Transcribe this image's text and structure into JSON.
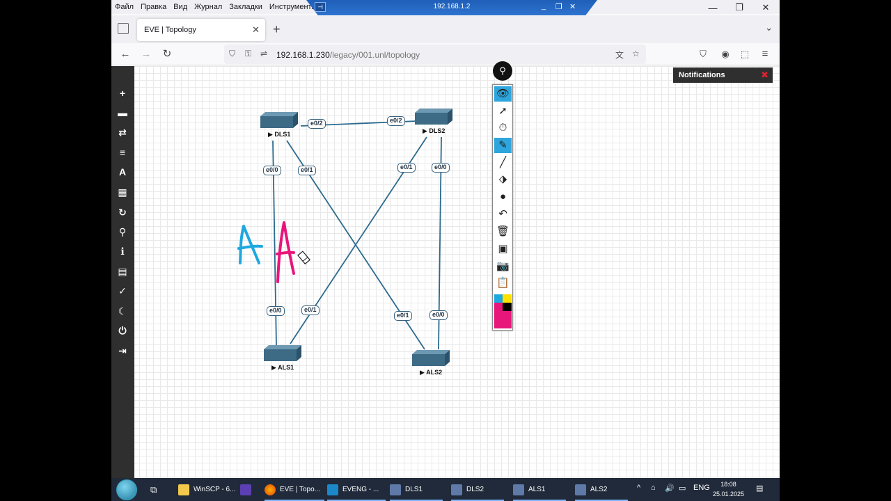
{
  "menubar": {
    "items": [
      "Файл",
      "Правка",
      "Вид",
      "Журнал",
      "Закладки",
      "Инструменты"
    ]
  },
  "rdp": {
    "title": "192.168.1.2",
    "pin": "⊣"
  },
  "tab": {
    "title": "EVE | Topology"
  },
  "url": {
    "host": "192.168.1.230",
    "path": "/legacy/001.unl/topology"
  },
  "notifications": {
    "title": "Notifications"
  },
  "topology": {
    "nodes": [
      {
        "id": "dls1",
        "label": "DLS1"
      },
      {
        "id": "dls2",
        "label": "DLS2"
      },
      {
        "id": "als1",
        "label": "ALS1"
      },
      {
        "id": "als2",
        "label": "ALS2"
      }
    ],
    "interfaces": {
      "dls1_e02": "e0/2",
      "dls2_e02": "e0/2",
      "dls1_e00": "e0/0",
      "dls1_e01": "e0/1",
      "dls2_e01": "e0/1",
      "dls2_e00": "e0/0",
      "als1_e00": "e0/0",
      "als1_e01": "e0/1",
      "als2_e01": "e0/1",
      "als2_e00": "e0/0"
    },
    "annotations": {
      "blue_letter": "A",
      "pink_letter": "A"
    }
  },
  "colors": {
    "link": "#2b6a8e",
    "blue_ink": "#1ea8e0",
    "pink_ink": "#e8157a",
    "tool_active": "#2ea6dd"
  },
  "taskbar": {
    "items": [
      {
        "label": "WinSCP - 6...",
        "icon": "winscp-icon"
      },
      {
        "label": "",
        "icon": "save-disk-icon"
      },
      {
        "label": "EVE | Topo...",
        "icon": "firefox-icon"
      },
      {
        "label": "EVENG - ...",
        "icon": "vmware-icon"
      },
      {
        "label": "DLS1",
        "icon": "terminal-icon"
      },
      {
        "label": "DLS2",
        "icon": "terminal-icon"
      },
      {
        "label": "ALS1",
        "icon": "terminal-icon"
      },
      {
        "label": "ALS2",
        "icon": "terminal-icon"
      }
    ],
    "lang": "ENG",
    "time": "18:08",
    "date": "25.01.2025"
  }
}
